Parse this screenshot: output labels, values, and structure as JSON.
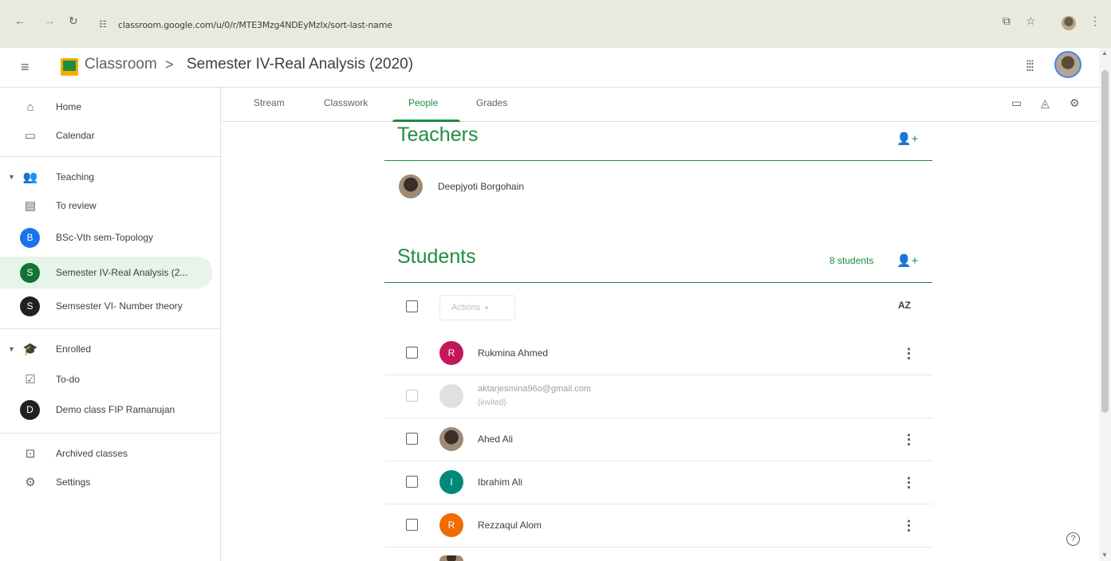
{
  "browser": {
    "url": "classroom.google.com/u/0/r/MTE3Mzg4NDEyMzIx/sort-last-name"
  },
  "header": {
    "app_name": "Classroom",
    "separator": ">",
    "class_name": "Semester IV-Real Analysis (2020)"
  },
  "sidebar": {
    "items": [
      {
        "label": "Home",
        "icon": "home-icon"
      },
      {
        "label": "Calendar",
        "icon": "calendar-icon"
      },
      {
        "label": "Teaching",
        "icon": "teaching-icon"
      },
      {
        "label": "To review",
        "icon": "folder-review-icon"
      },
      {
        "label": "BSc-Vth sem-Topology",
        "avatar": "B",
        "color": "#1a73e8"
      },
      {
        "label": "Semester IV-Real Analysis (2...",
        "avatar": "S",
        "color": "#137333"
      },
      {
        "label": "Semsester VI- Number theory",
        "avatar": "S",
        "color": "#202124"
      },
      {
        "label": "Enrolled",
        "icon": "enrolled-icon"
      },
      {
        "label": "To-do",
        "icon": "todo-icon"
      },
      {
        "label": "Demo class FIP Ramanujan",
        "avatar": "D",
        "color": "#202124"
      },
      {
        "label": "Archived classes",
        "icon": "archive-icon"
      },
      {
        "label": "Settings",
        "icon": "settings-icon"
      }
    ]
  },
  "tabs": {
    "stream": "Stream",
    "classwork": "Classwork",
    "people": "People",
    "grades": "Grades",
    "active": "People"
  },
  "teachers": {
    "title": "Teachers",
    "list": [
      {
        "name": "Deepjyoti Borgohain"
      }
    ]
  },
  "students": {
    "title": "Students",
    "count_label": "8 students",
    "actions_label": "Actions",
    "actions_arrow": "▾",
    "sort_label": "AZ",
    "list": [
      {
        "name": "Rukmina Ahmed",
        "avatar": "R",
        "color": "#c2185b"
      },
      {
        "name": "aktarjesmina96o@gmail.com",
        "status": "(invited)"
      },
      {
        "name": "Ahed Ali",
        "photo": true
      },
      {
        "name": "Ibrahim Ali",
        "avatar": "I",
        "color": "#00897b"
      },
      {
        "name": "Rezzaqul Alom",
        "avatar": "R",
        "color": "#ef6c00"
      }
    ]
  },
  "colors": {
    "accent": "#1e8e3e",
    "browser_bar": "#e8eadd"
  },
  "help_icon_text": "?"
}
